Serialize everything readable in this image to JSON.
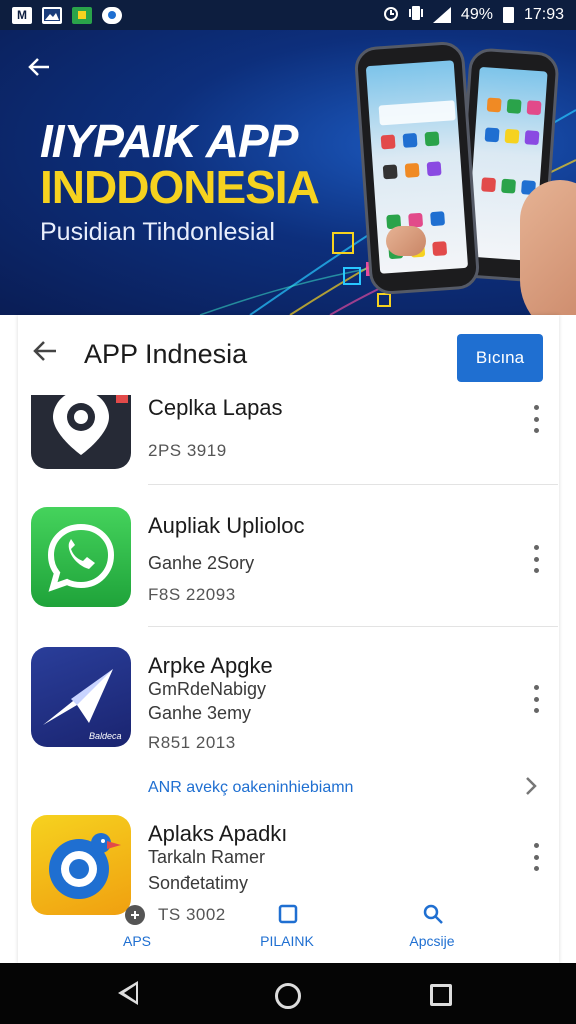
{
  "status_bar": {
    "battery": "49%",
    "time": "17:93",
    "left_icons": [
      "m-icon",
      "gallery-icon",
      "app-icon",
      "cloud-icon"
    ]
  },
  "banner": {
    "title_line1": "IIYPAIK APP",
    "title_line2": "INDDONESIA",
    "subtitle": "Pusidian Tihdonlesial"
  },
  "header": {
    "title": "APP Indnesia",
    "button_label": "Bıcına"
  },
  "apps": [
    {
      "name": "Ceplka Lapas",
      "line1": "",
      "line2": "",
      "meta": "2PS 3919",
      "icon": "location-pin-icon"
    },
    {
      "name": "Aupliak Uplioloc",
      "line1": "Ganhe 2Sory",
      "line2": "",
      "meta": "F8S 22093",
      "icon": "chat-bubble-icon"
    },
    {
      "name": "Arpke Apgke",
      "line1": "GmRdeNabigy",
      "line2": "Ganhe 3emy",
      "meta": "R851 2013",
      "icon": "paper-plane-icon",
      "icon_text": "Baldeca"
    },
    {
      "name": "Aplaks Apadkı",
      "line1": "Tarkaln Ramer",
      "line2": "Sonđetatimy",
      "meta": "TS 3002",
      "icon": "bird-camera-icon"
    }
  ],
  "link": {
    "label": "ANR avekç oakeninhiebiamn"
  },
  "tabs": [
    {
      "label": "APS",
      "icon": "apps-icon"
    },
    {
      "label": "PILAINK",
      "icon": "square-icon"
    },
    {
      "label": "Apcsije",
      "icon": "search-icon"
    }
  ],
  "colors": {
    "accent": "#1f6fd1",
    "banner_yellow": "#f6d21f",
    "banner_blue": "#0d2f7c"
  }
}
